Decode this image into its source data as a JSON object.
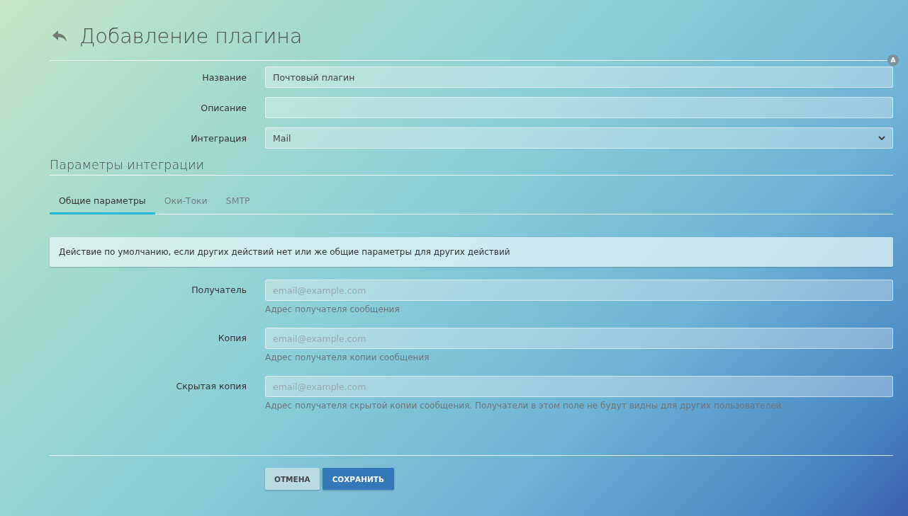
{
  "page": {
    "title": "Добавление плагина",
    "badge": "A"
  },
  "fields": [
    {
      "label": "Название",
      "kind": "text",
      "value": "Почтовый плагин"
    },
    {
      "label": "Описание",
      "kind": "text"
    },
    {
      "label": "Интеграция",
      "kind": "select",
      "value": "Mail"
    }
  ],
  "section": {
    "title": "Параметры интеграции"
  },
  "tabs": [
    {
      "label": "Общие параметры",
      "selected": true
    },
    {
      "label": "Оки-Токи",
      "selected": false
    },
    {
      "label": "SMTP",
      "selected": false
    }
  ],
  "alert": "Действие по умолчанию, если других действий нет или же общие параметры для других действий",
  "email_fields": [
    {
      "label": "Получатель",
      "placeholder": "email@example.com",
      "help": "Адрес получателя сообщения"
    },
    {
      "label": "Копия",
      "placeholder": "email@example.com",
      "help": "Адрес получателя копии сообщения"
    },
    {
      "label": "Скрытая копия",
      "placeholder": "email@example.com",
      "help": "Адрес получателя скрытой копии сообщения. Получатели в этом поле не будут видны для других пользователей"
    }
  ],
  "buttons": [
    {
      "label": "ОТМЕНА",
      "kind": "secondary"
    },
    {
      "label": "СОХРАНИТЬ",
      "kind": "primary"
    }
  ]
}
